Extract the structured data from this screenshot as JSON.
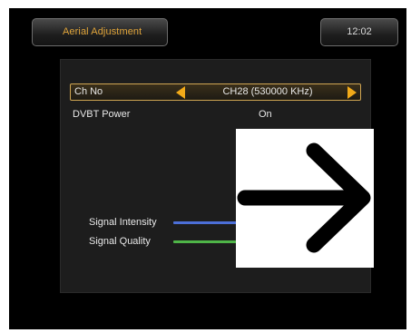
{
  "header": {
    "title": "Aerial Adjustment",
    "clock": "12:02"
  },
  "settings": {
    "channel": {
      "label": "Ch No",
      "value": "CH28 (530000 KHz)"
    },
    "dvbt_power": {
      "label": "DVBT Power",
      "value": "On"
    }
  },
  "signal": {
    "intensity": {
      "label": "Signal Intensity",
      "level": 0.46,
      "color": "#4c6fd8"
    },
    "quality": {
      "label": "Signal Quality",
      "level": 0.46,
      "color": "#4fb548"
    }
  },
  "colors": {
    "accent": "#f2aa19",
    "title_text": "#e0a43a",
    "background": "#000000",
    "panel": "#1d1d1d"
  },
  "overlay": {
    "icon": "right-arrow-icon"
  }
}
